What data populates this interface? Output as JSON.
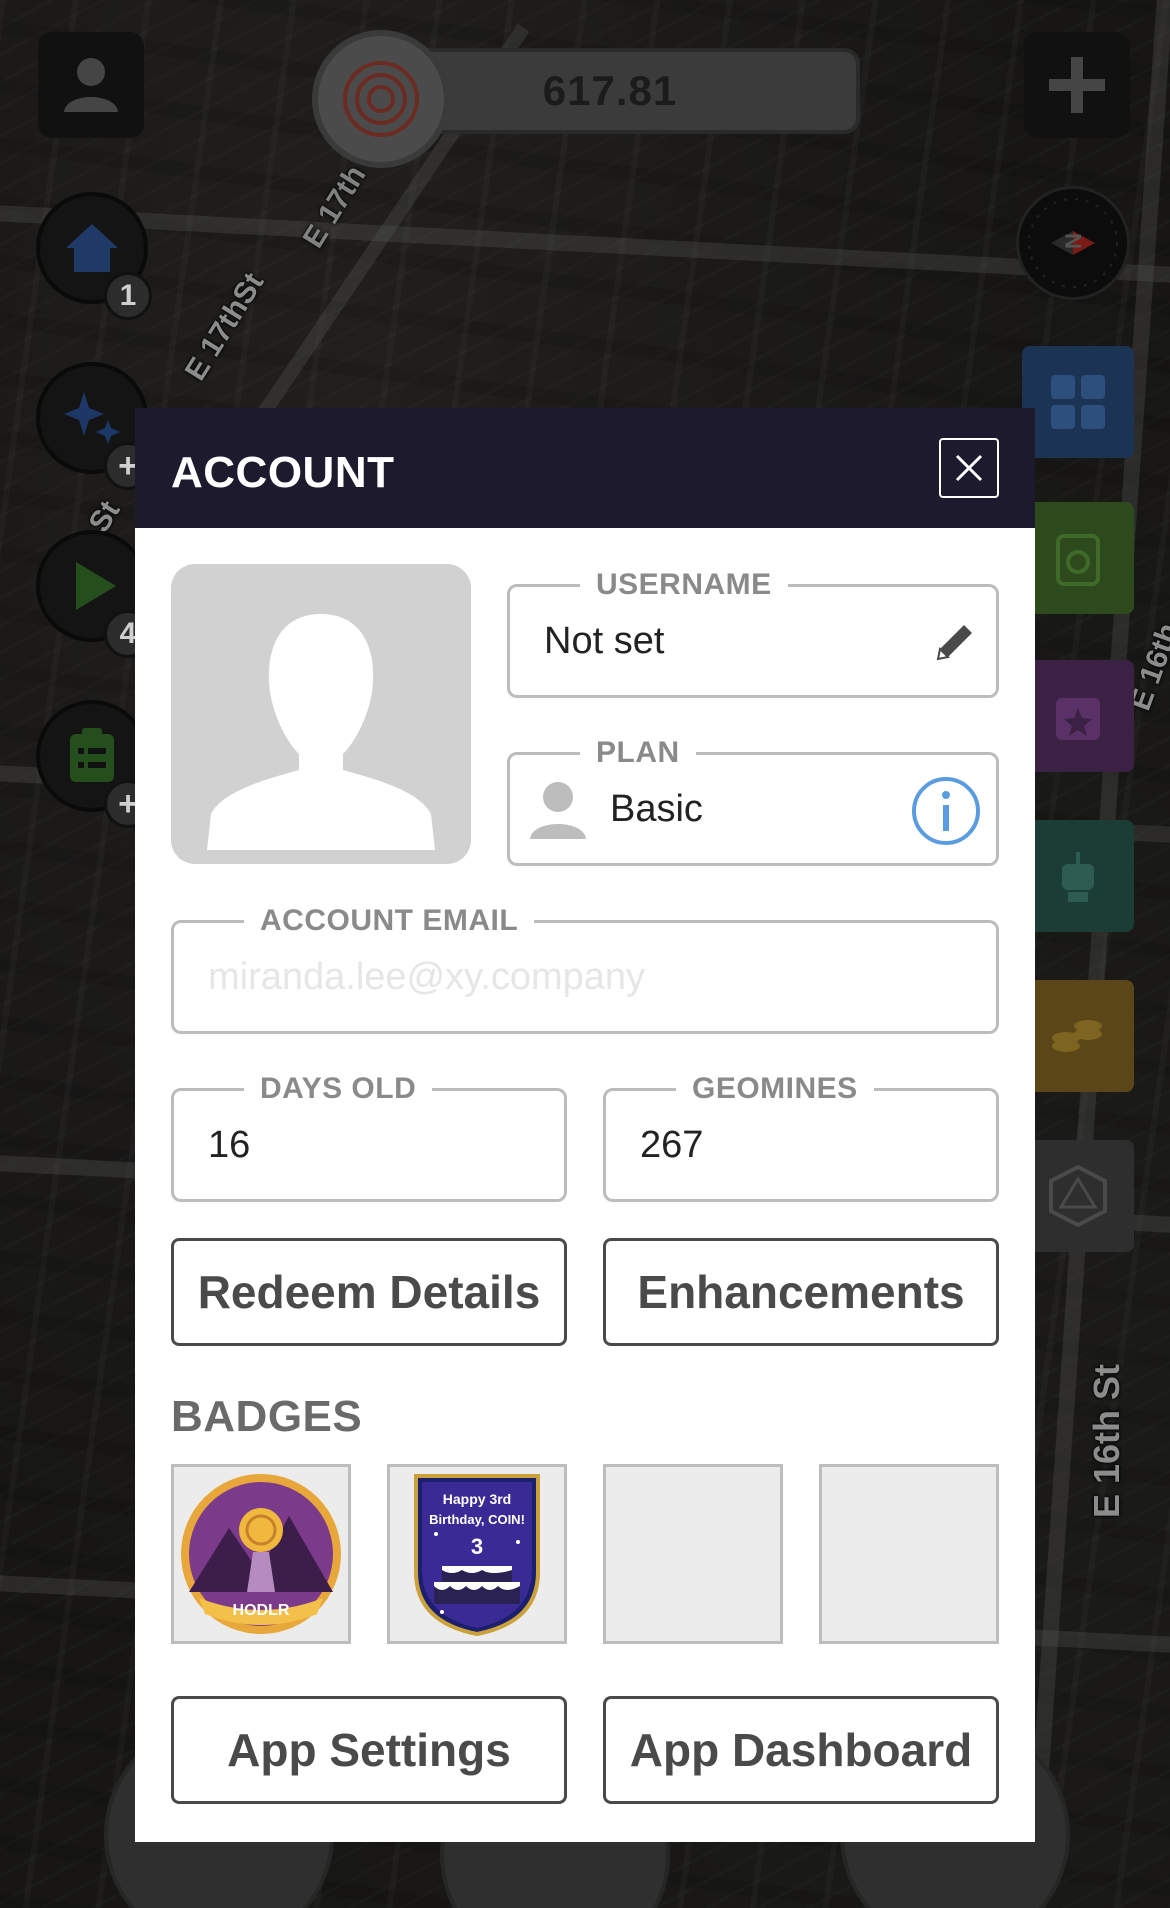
{
  "map": {
    "street_labels": [
      "E 17th St",
      "E 17thSt",
      "St",
      "E 16th St",
      "E 16th",
      "E 17th"
    ]
  },
  "hud": {
    "coin_balance": "617.81",
    "home_badge_count": "1",
    "play_badge_count": "4",
    "compass_letter": "N"
  },
  "account": {
    "title": "ACCOUNT",
    "username": {
      "label": "USERNAME",
      "value": "Not set"
    },
    "plan": {
      "label": "PLAN",
      "value": "Basic"
    },
    "email": {
      "label": "ACCOUNT EMAIL",
      "placeholder": "miranda.lee@xy.company"
    },
    "days_old": {
      "label": "DAYS OLD",
      "value": "16"
    },
    "geomines": {
      "label": "GEOMINES",
      "value": "267"
    },
    "redeem_label": "Redeem Details",
    "enhancements_label": "Enhancements",
    "badges_title": "BADGES",
    "badges": [
      {
        "icon": "hodlr-badge-icon",
        "text": "HODLR"
      },
      {
        "icon": "birthday-badge-icon",
        "text_line1": "Happy 3rd",
        "text_line2": "Birthday, COIN!",
        "number": "3"
      },
      {
        "icon": "empty-badge-slot"
      },
      {
        "icon": "empty-badge-slot"
      }
    ],
    "app_settings_label": "App Settings",
    "app_dashboard_label": "App Dashboard"
  },
  "colors": {
    "header_bg": "#1c1a2c",
    "info_blue": "#5b9be0",
    "button_border": "#4a4a4a",
    "field_border": "#bcbcbc"
  }
}
